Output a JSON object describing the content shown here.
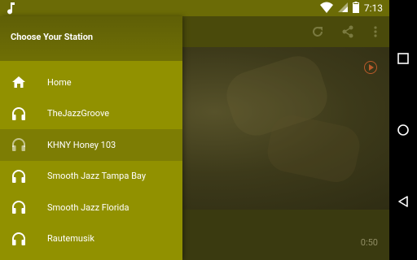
{
  "status_bar": {
    "time": "7:13",
    "icons": [
      "music-note-icon",
      "wifi-icon",
      "cell-signal-icon",
      "battery-icon"
    ]
  },
  "drawer": {
    "title": "Choose Your Station",
    "items": [
      {
        "label": "Home",
        "icon": "home-icon",
        "selected": false
      },
      {
        "label": "TheJazzGroove",
        "icon": "headphones-icon",
        "selected": false
      },
      {
        "label": "KHNY Honey 103",
        "icon": "headphones-icon",
        "selected": true
      },
      {
        "label": "Smooth Jazz Tampa Bay",
        "icon": "headphones-icon",
        "selected": false
      },
      {
        "label": "Smooth Jazz Florida",
        "icon": "headphones-icon",
        "selected": false
      },
      {
        "label": "Rautemusik",
        "icon": "headphones-icon",
        "selected": false
      }
    ]
  },
  "app": {
    "toolbar_icons": [
      "refresh-icon",
      "share-icon",
      "more-vert-icon"
    ],
    "elapsed_time": "0:50"
  },
  "nav_bar": [
    "recents-button",
    "home-button",
    "back-button"
  ],
  "colors": {
    "drawer_bg": "#919100",
    "selected_bg": "#7d7d04",
    "status_bar": "#6b6b06",
    "accent_play": "#b85a2a"
  }
}
